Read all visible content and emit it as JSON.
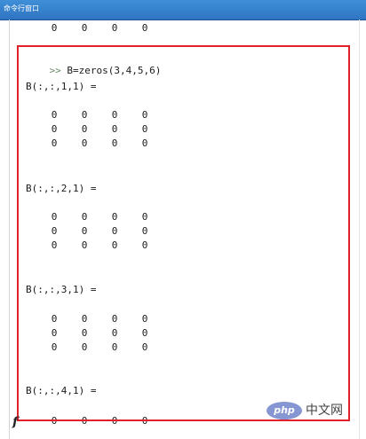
{
  "window": {
    "title": "命令行窗口"
  },
  "top_row": {
    "values": [
      "0",
      "0",
      "0",
      "0"
    ]
  },
  "command": {
    "prompt": ">>",
    "text": "B=zeros(3,4,5,6)"
  },
  "pages": [
    {
      "label": "B(:,:,1,1) =",
      "rows": [
        [
          "0",
          "0",
          "0",
          "0"
        ],
        [
          "0",
          "0",
          "0",
          "0"
        ],
        [
          "0",
          "0",
          "0",
          "0"
        ]
      ]
    },
    {
      "label": "B(:,:,2,1) =",
      "rows": [
        [
          "0",
          "0",
          "0",
          "0"
        ],
        [
          "0",
          "0",
          "0",
          "0"
        ],
        [
          "0",
          "0",
          "0",
          "0"
        ]
      ]
    },
    {
      "label": "B(:,:,3,1) =",
      "rows": [
        [
          "0",
          "0",
          "0",
          "0"
        ],
        [
          "0",
          "0",
          "0",
          "0"
        ],
        [
          "0",
          "0",
          "0",
          "0"
        ]
      ]
    },
    {
      "label": "B(:,:,4,1) =",
      "rows": [
        [
          "0",
          "0",
          "0",
          "0"
        ]
      ]
    }
  ],
  "partial_glyph": "f",
  "watermark": {
    "logo": "php",
    "text": "中文网"
  },
  "colors": {
    "titlebar": "#2f74c2",
    "highlight": "#e0202a",
    "text": "#1a1a1a"
  }
}
